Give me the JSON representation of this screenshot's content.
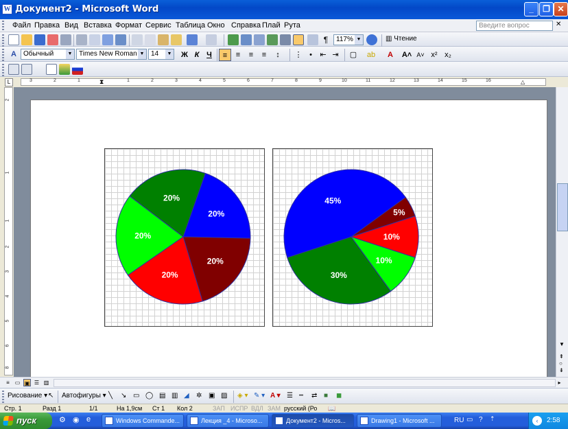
{
  "window": {
    "title": "Документ2 - Microsoft Word",
    "app_icon": "W"
  },
  "menu": {
    "items": [
      "Файл",
      "Правка",
      "Вид",
      "Вставка",
      "Формат",
      "Сервис",
      "Таблица",
      "Окно",
      "Справка",
      "Плай",
      "Рута"
    ],
    "ask_placeholder": "Введите вопрос"
  },
  "standard_toolbar": {
    "zoom": "117%",
    "reading_label": "Чтение"
  },
  "format_toolbar": {
    "style": "Обычный",
    "font": "Times New Roman",
    "size": "14"
  },
  "ruler": {
    "h_numbers": [
      "3",
      "2",
      "1",
      "1",
      "2",
      "3",
      "4",
      "5",
      "6",
      "7",
      "8",
      "9",
      "10",
      "11",
      "12",
      "13",
      "14",
      "15",
      "16"
    ],
    "v_numbers": [
      "2",
      "1",
      "1",
      "2",
      "3",
      "4",
      "5",
      "6",
      "7",
      "8"
    ]
  },
  "chart_data": [
    {
      "type": "pie",
      "title": "",
      "slices": [
        {
          "label": "20%",
          "value": 20,
          "color": "#0000ff"
        },
        {
          "label": "20%",
          "value": 20,
          "color": "#800000"
        },
        {
          "label": "20%",
          "value": 20,
          "color": "#ff0000"
        },
        {
          "label": "20%",
          "value": 20,
          "color": "#00ff00"
        },
        {
          "label": "20%",
          "value": 20,
          "color": "#008000"
        }
      ]
    },
    {
      "type": "pie",
      "title": "",
      "slices": [
        {
          "label": "45%",
          "value": 45,
          "color": "#0000ff"
        },
        {
          "label": "5%",
          "value": 5,
          "color": "#800000"
        },
        {
          "label": "10%",
          "value": 10,
          "color": "#ff0000"
        },
        {
          "label": "10%",
          "value": 10,
          "color": "#00ff00"
        },
        {
          "label": "30%",
          "value": 30,
          "color": "#008000"
        }
      ]
    }
  ],
  "drawing_toolbar": {
    "draw_label": "Рисование",
    "autoshapes_label": "Автофигуры"
  },
  "status": {
    "page": "Стр. 1",
    "section": "Разд 1",
    "pages": "1/1",
    "at": "На 1,9см",
    "line": "Ст 1",
    "col": "Кол 2",
    "rec": "ЗАП",
    "trk": "ИСПР",
    "ext": "ВДЛ",
    "ovr": "ЗАМ",
    "lang": "русский (Ро"
  },
  "taskbar": {
    "start_label": "пуск",
    "tasks": [
      {
        "label": "Windows Commande...",
        "active": false
      },
      {
        "label": "Лекция _4 - Microso...",
        "active": false
      },
      {
        "label": "Документ2 - Micros...",
        "active": true
      },
      {
        "label": "Drawing1 - Microsoft ...",
        "active": false
      }
    ],
    "lang": "RU",
    "clock": "2:58"
  }
}
